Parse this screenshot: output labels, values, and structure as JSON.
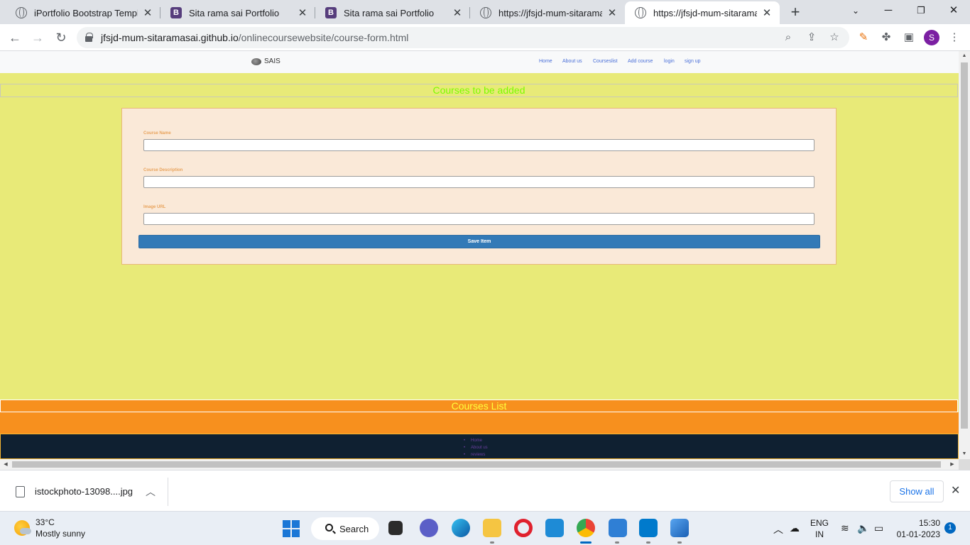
{
  "browser": {
    "tabs": [
      {
        "title": "iPortfolio Bootstrap Template",
        "icon": "globe-icon",
        "active": false
      },
      {
        "title": "Sita rama sai Portfolio",
        "icon": "bootstrap-icon",
        "active": false
      },
      {
        "title": "Sita rama sai Portfolio",
        "icon": "bootstrap-icon",
        "active": false
      },
      {
        "title": "https://jfsjd-mum-sitaramasai",
        "icon": "globe-icon",
        "active": false
      },
      {
        "title": "https://jfsjd-mum-sitaramasai",
        "icon": "globe-icon",
        "active": true
      }
    ],
    "new_tab_glyph": "+",
    "close_glyph": "✕",
    "address": {
      "host": "jfsjd-mum-sitaramasai.github.io",
      "path": "/onlinecoursewebsite/course-form.html"
    },
    "profile_initial": "S"
  },
  "page": {
    "brand": "SAIS",
    "nav_links": [
      "Home",
      "About us",
      "Courseslist",
      "Add course",
      "login",
      "sign up"
    ],
    "form_heading": "Courses to be added",
    "fields": [
      {
        "label": "Course Name",
        "value": ""
      },
      {
        "label": "Course Description",
        "value": ""
      },
      {
        "label": "Image URL",
        "value": ""
      }
    ],
    "save_button": "Save Item",
    "courses_list_heading": "Courses List",
    "footer_links": [
      "Home",
      "About us",
      "reviews"
    ]
  },
  "downloads": {
    "file_name": "istockphoto-13098....jpg",
    "show_all": "Show all"
  },
  "taskbar": {
    "weather_temp": "33°C",
    "weather_condition": "Mostly sunny",
    "search_label": "Search",
    "lang_top": "ENG",
    "lang_bottom": "IN",
    "time": "15:30",
    "date": "01-01-2023",
    "notification_count": "1"
  },
  "colors": {
    "page_bg": "#e8ea78",
    "form_heading": "#7cfc00",
    "form_card_bg": "#fae9d8",
    "field_label": "#e8a35c",
    "save_button_bg": "#337ab7",
    "courses_list_bg": "#f7901e",
    "courses_list_text": "#ffff3c",
    "footer_bg": "#0f2031"
  }
}
